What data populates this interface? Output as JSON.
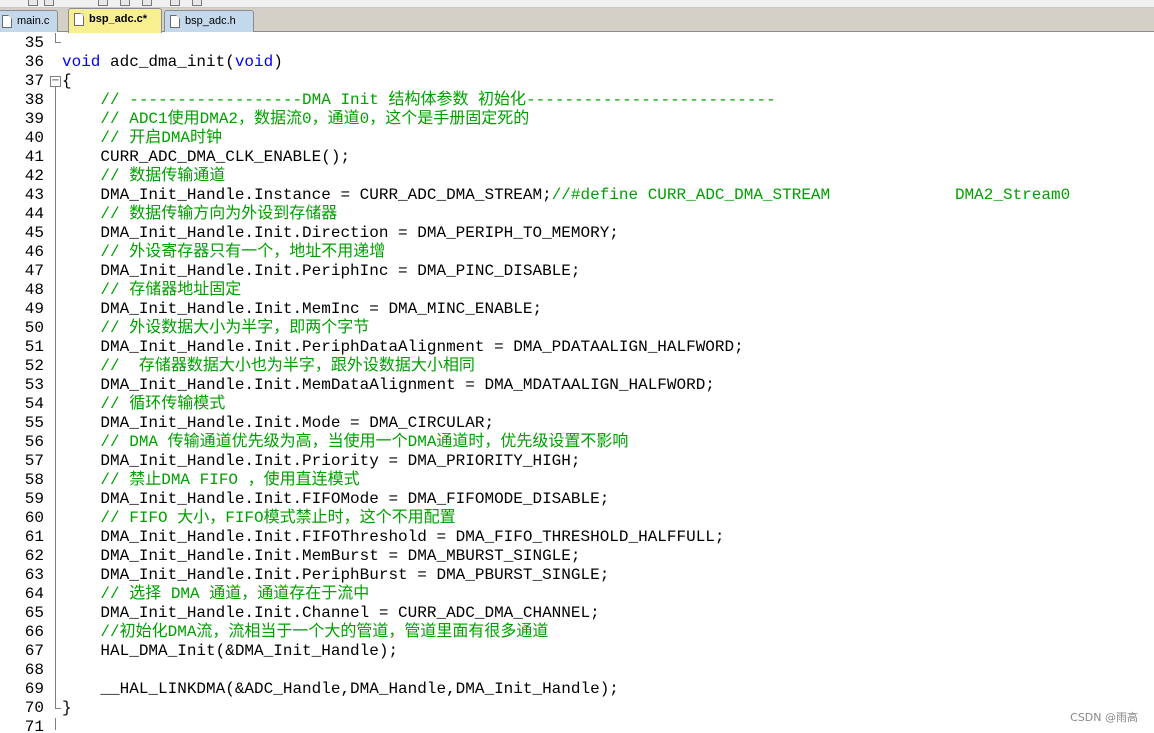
{
  "tabs": [
    {
      "label": "main.c",
      "active": false
    },
    {
      "label": "bsp_adc.c*",
      "active": true
    },
    {
      "label": "bsp_adc.h",
      "active": false
    }
  ],
  "lines": [
    {
      "n": "35",
      "t": "",
      "type": "plain"
    },
    {
      "n": "36",
      "t": "void adc_dma_init(void)",
      "type": "plain"
    },
    {
      "n": "37",
      "t": "{",
      "type": "plain"
    },
    {
      "n": "38",
      "t": "    // ------------------DMA Init 结构体参数 初始化--------------------------",
      "type": "comment"
    },
    {
      "n": "39",
      "t": "    // ADC1使用DMA2，数据流0，通道0，这个是手册固定死的",
      "type": "comment"
    },
    {
      "n": "40",
      "t": "    // 开启DMA时钟",
      "type": "comment"
    },
    {
      "n": "41",
      "t": "    CURR_ADC_DMA_CLK_ENABLE();",
      "type": "plain"
    },
    {
      "n": "42",
      "t": "    // 数据传输通道",
      "type": "comment"
    },
    {
      "n": "43",
      "t": "    DMA_Init_Handle.Instance = CURR_ADC_DMA_STREAM;",
      "tail": "//#define CURR_ADC_DMA_STREAM             DMA2_Stream0",
      "type": "mixed"
    },
    {
      "n": "44",
      "t": "    // 数据传输方向为外设到存储器",
      "type": "comment"
    },
    {
      "n": "45",
      "t": "    DMA_Init_Handle.Init.Direction = DMA_PERIPH_TO_MEMORY;",
      "type": "plain"
    },
    {
      "n": "46",
      "t": "    // 外设寄存器只有一个，地址不用递增",
      "type": "comment"
    },
    {
      "n": "47",
      "t": "    DMA_Init_Handle.Init.PeriphInc = DMA_PINC_DISABLE;",
      "type": "plain"
    },
    {
      "n": "48",
      "t": "    // 存储器地址固定",
      "type": "comment"
    },
    {
      "n": "49",
      "t": "    DMA_Init_Handle.Init.MemInc = DMA_MINC_ENABLE;",
      "type": "plain"
    },
    {
      "n": "50",
      "t": "    // 外设数据大小为半字，即两个字节",
      "type": "comment"
    },
    {
      "n": "51",
      "t": "    DMA_Init_Handle.Init.PeriphDataAlignment = DMA_PDATAALIGN_HALFWORD;",
      "type": "plain"
    },
    {
      "n": "52",
      "t": "    //  存储器数据大小也为半字，跟外设数据大小相同",
      "type": "comment"
    },
    {
      "n": "53",
      "t": "    DMA_Init_Handle.Init.MemDataAlignment = DMA_MDATAALIGN_HALFWORD;",
      "type": "plain"
    },
    {
      "n": "54",
      "t": "    // 循环传输模式",
      "type": "comment"
    },
    {
      "n": "55",
      "t": "    DMA_Init_Handle.Init.Mode = DMA_CIRCULAR;",
      "type": "plain"
    },
    {
      "n": "56",
      "t": "    // DMA 传输通道优先级为高，当使用一个DMA通道时，优先级设置不影响",
      "type": "comment"
    },
    {
      "n": "57",
      "t": "    DMA_Init_Handle.Init.Priority = DMA_PRIORITY_HIGH;",
      "type": "plain"
    },
    {
      "n": "58",
      "t": "    // 禁止DMA FIFO ，使用直连模式",
      "type": "comment"
    },
    {
      "n": "59",
      "t": "    DMA_Init_Handle.Init.FIFOMode = DMA_FIFOMODE_DISABLE;",
      "type": "plain"
    },
    {
      "n": "60",
      "t": "    // FIFO 大小，FIFO模式禁止时，这个不用配置",
      "type": "comment"
    },
    {
      "n": "61",
      "t": "    DMA_Init_Handle.Init.FIFOThreshold = DMA_FIFO_THRESHOLD_HALFFULL;",
      "type": "plain"
    },
    {
      "n": "62",
      "t": "    DMA_Init_Handle.Init.MemBurst = DMA_MBURST_SINGLE;",
      "type": "plain"
    },
    {
      "n": "63",
      "t": "    DMA_Init_Handle.Init.PeriphBurst = DMA_PBURST_SINGLE;",
      "type": "plain"
    },
    {
      "n": "64",
      "t": "    // 选择 DMA 通道，通道存在于流中",
      "type": "comment"
    },
    {
      "n": "65",
      "t": "    DMA_Init_Handle.Init.Channel = CURR_ADC_DMA_CHANNEL;",
      "type": "plain"
    },
    {
      "n": "66",
      "t": "    //初始化DMA流，流相当于一个大的管道，管道里面有很多通道",
      "type": "comment"
    },
    {
      "n": "67",
      "t": "    HAL_DMA_Init(&DMA_Init_Handle);",
      "type": "plain"
    },
    {
      "n": "68",
      "t": "",
      "type": "plain"
    },
    {
      "n": "69",
      "t": "    __HAL_LINKDMA(&ADC_Handle,DMA_Handle,DMA_Init_Handle);",
      "type": "plain"
    },
    {
      "n": "70",
      "t": "}",
      "type": "plain"
    },
    {
      "n": "71",
      "t": "",
      "type": "plain"
    }
  ],
  "watermark": "CSDN @雨高",
  "colors": {
    "comment": "#00a000",
    "keyword": "#0000ff",
    "active_tab": "#f8f090",
    "inactive_tab": "#c4d8ec"
  }
}
